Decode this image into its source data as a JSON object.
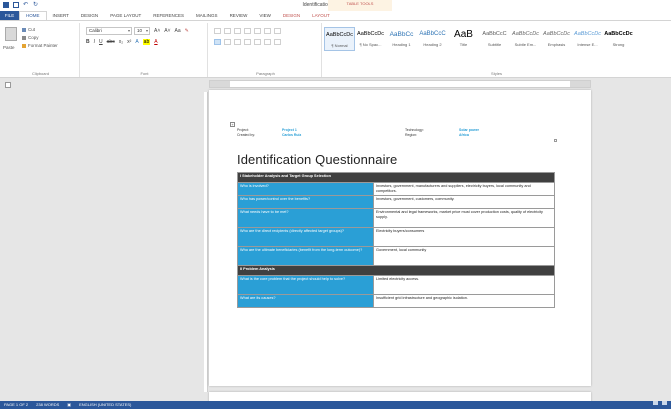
{
  "window": {
    "title": "Identification Checklist - Word",
    "contextual_tab_group": "TABLE TOOLS"
  },
  "ribbon_tabs": [
    "FILE",
    "HOME",
    "INSERT",
    "DESIGN",
    "PAGE LAYOUT",
    "REFERENCES",
    "MAILINGS",
    "REVIEW",
    "VIEW",
    "DESIGN",
    "LAYOUT"
  ],
  "clipboard": {
    "cut": "Cut",
    "copy": "Copy",
    "paste": "Paste",
    "format_painter": "Format Painter",
    "group_label": "Clipboard"
  },
  "font": {
    "name": "Calibri",
    "size": "10",
    "group_label": "Font"
  },
  "paragraph": {
    "group_label": "Paragraph"
  },
  "styles": {
    "group_label": "Styles",
    "items": [
      {
        "sample": "AaBbCcDc",
        "name": "¶ Normal"
      },
      {
        "sample": "AaBbCcDc",
        "name": "¶ No Spac..."
      },
      {
        "sample": "AaBbCc",
        "name": "Heading 1"
      },
      {
        "sample": "AaBbCcC",
        "name": "Heading 2"
      },
      {
        "sample": "AaB",
        "name": "Title"
      },
      {
        "sample": "AaBbCcC",
        "name": "Subtitle"
      },
      {
        "sample": "AaBbCcDc",
        "name": "Subtle Em..."
      },
      {
        "sample": "AaBbCcDc",
        "name": "Emphasis"
      },
      {
        "sample": "AaBbCcDc",
        "name": "Intense E..."
      },
      {
        "sample": "AaBbCcDc",
        "name": "Strong"
      }
    ]
  },
  "document": {
    "project_label": "Project:",
    "project_value": "Project 1",
    "created_label": "Created by:",
    "created_value": "Carlos Ruiz",
    "technology_label": "Technology:",
    "technology_value": "Solar power",
    "region_label": "Region:",
    "region_value": "Africa",
    "heading": "Identification Questionnaire",
    "section1": "I Stakeholder Analysis and Target Group Selection",
    "rows1": [
      {
        "q": "Who is involved?",
        "a": "Investors, government, manufacturers and suppliers, electricity buyers, local community and competitors."
      },
      {
        "q": "Who has power/control over the benefits?",
        "a": "Investors, government, customers, community."
      },
      {
        "q": "What needs have to be met?",
        "a": "Environmental and legal frameworks, market price must cover production costs, quality of electricity supply."
      },
      {
        "q": "Who are the direct recipients (directly affected target groups)?",
        "a": "Electricity buyers/consumers"
      },
      {
        "q": "Who are the ultimate beneficiaries (benefit from the long-term outcome)?",
        "a": "Government, local community"
      }
    ],
    "section2": "II Problem Analysis",
    "rows2": [
      {
        "q": "What is the core problem that the project should help to solve?",
        "a": "Limited electricity access."
      },
      {
        "q": "What are its causes?",
        "a": "Insufficient grid infrastructure and geographic isolation."
      }
    ]
  },
  "status": {
    "page": "PAGE 1 OF 2",
    "words": "238 WORDS",
    "language": "ENGLISH (UNITED STATES)"
  },
  "colors": {
    "accent": "#2b579a",
    "question_cell": "#2a9fd6",
    "section_header": "#404040"
  }
}
